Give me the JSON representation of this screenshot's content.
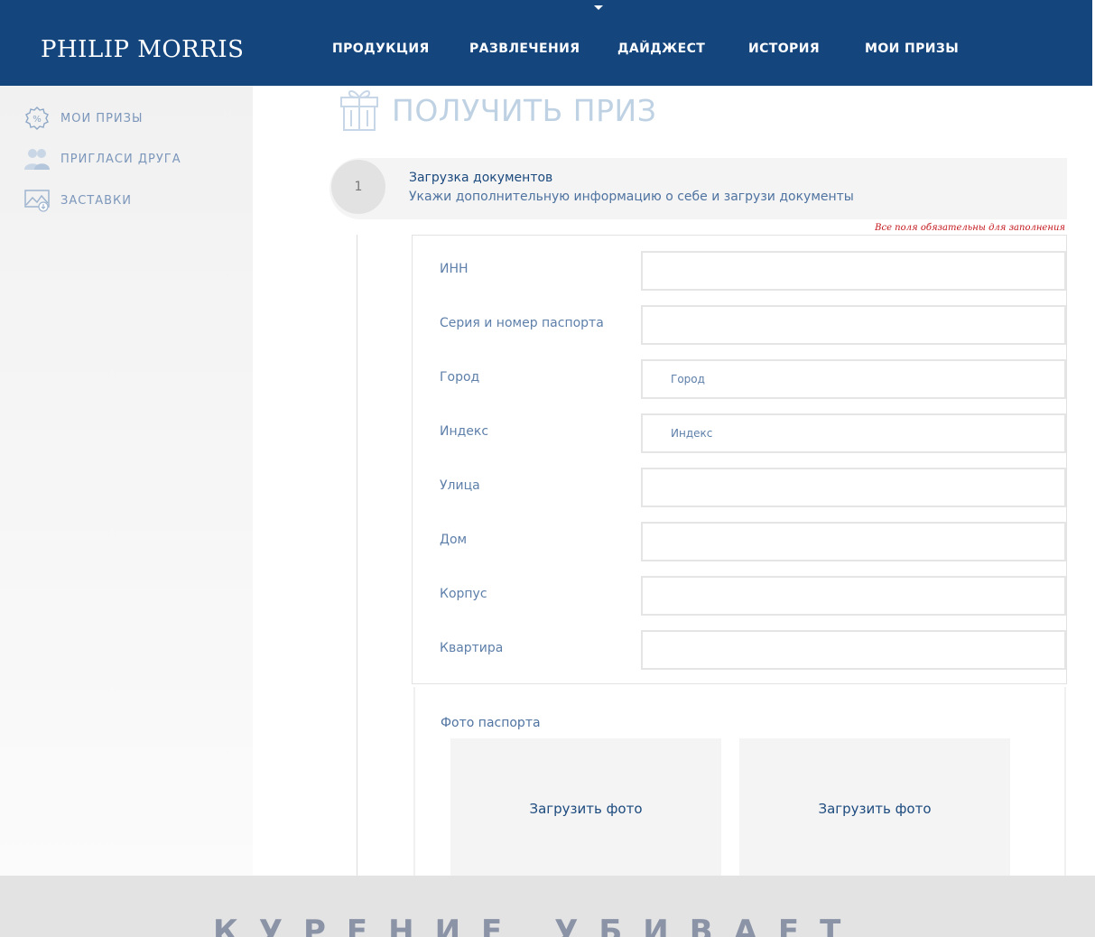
{
  "header": {
    "logo": "PHILIP MORRIS",
    "nav": [
      "ПРОДУКЦИЯ",
      "РАЗВЛЕЧЕНИЯ",
      "ДАЙДЖЕСТ",
      "ИСТОРИЯ",
      "МОИ ПРИЗЫ"
    ]
  },
  "sidebar": {
    "items": [
      {
        "label": "МОИ ПРИЗЫ",
        "icon": "percent-badge-icon"
      },
      {
        "label": "ПРИГЛАСИ ДРУГА",
        "icon": "users-icon"
      },
      {
        "label": "ЗАСТАВКИ",
        "icon": "image-download-icon"
      }
    ]
  },
  "page": {
    "title": "ПОЛУЧИТЬ ПРИЗ",
    "title_icon": "gift-icon"
  },
  "step": {
    "number": "1",
    "title": "Загрузка документов",
    "subtitle": "Укажи дополнительную информацию о себе и загрузи документы"
  },
  "form": {
    "required_note": "Все поля обязательны для заполнения",
    "fields": [
      {
        "label": "ИНН",
        "value": "",
        "placeholder": ""
      },
      {
        "label": "Серия и номер паспорта",
        "value": "",
        "placeholder": ""
      },
      {
        "label": "Город",
        "value": "",
        "placeholder": "Город"
      },
      {
        "label": "Индекс",
        "value": "",
        "placeholder": "Индекс"
      },
      {
        "label": "Улица",
        "value": "",
        "placeholder": ""
      },
      {
        "label": "Дом",
        "value": "",
        "placeholder": ""
      },
      {
        "label": "Корпус",
        "value": "",
        "placeholder": ""
      },
      {
        "label": "Квартира",
        "value": "",
        "placeholder": ""
      }
    ]
  },
  "photos": {
    "title": "Фото паспорта",
    "upload_labels": [
      "Загрузить фото",
      "Загрузить фото"
    ]
  },
  "footer": {
    "warning": "КУРЕНИЕ УБИВАЕТ"
  },
  "colors": {
    "header_bg": "#14457d",
    "accent": "#1c4a7e",
    "muted_blue": "#5d7fa9",
    "required_red": "#c4161c"
  }
}
